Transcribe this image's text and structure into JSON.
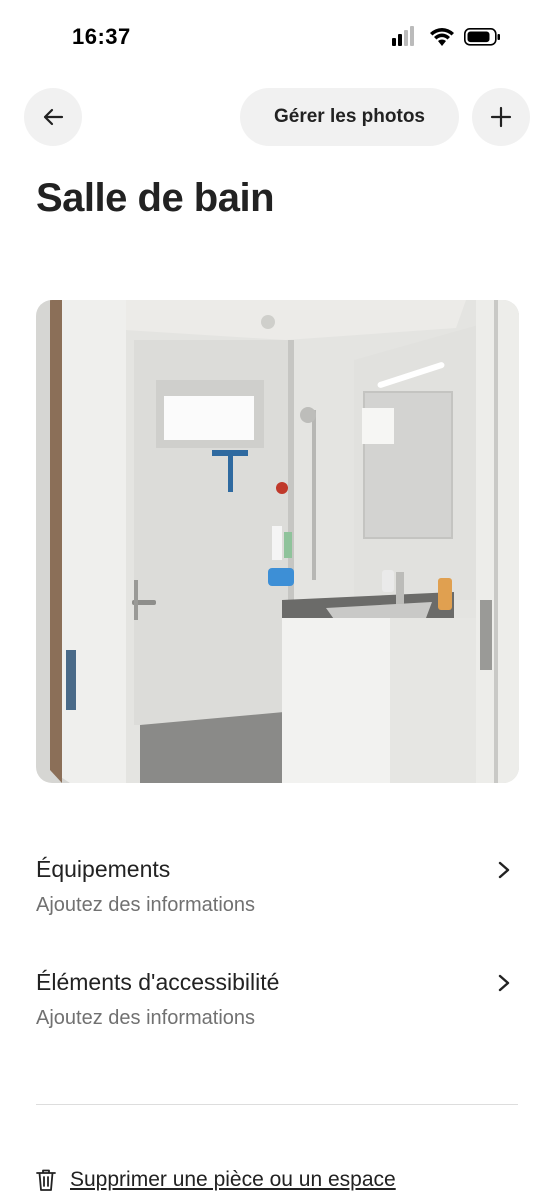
{
  "status_bar": {
    "time": "16:37",
    "icons": [
      "signal-icon",
      "wifi-icon",
      "battery-icon"
    ]
  },
  "nav": {
    "back_icon": "arrow-left-icon",
    "manage_photos_label": "Gérer les photos",
    "add_icon": "plus-icon"
  },
  "page": {
    "title": "Salle de bain"
  },
  "photo": {
    "subject": "bathroom-photo"
  },
  "sections": [
    {
      "title": "Équipements",
      "subtitle": "Ajoutez des informations",
      "icon": "chevron-right-icon"
    },
    {
      "title": "Éléments d'accessibilité",
      "subtitle": "Ajoutez des informations",
      "icon": "chevron-right-icon"
    }
  ],
  "delete": {
    "label": "Supprimer une pièce ou un espace",
    "icon": "trash-icon"
  },
  "colors": {
    "text": "#222222",
    "muted": "#717171",
    "button_bg": "#f1f1f1",
    "divider": "#dddddd"
  }
}
